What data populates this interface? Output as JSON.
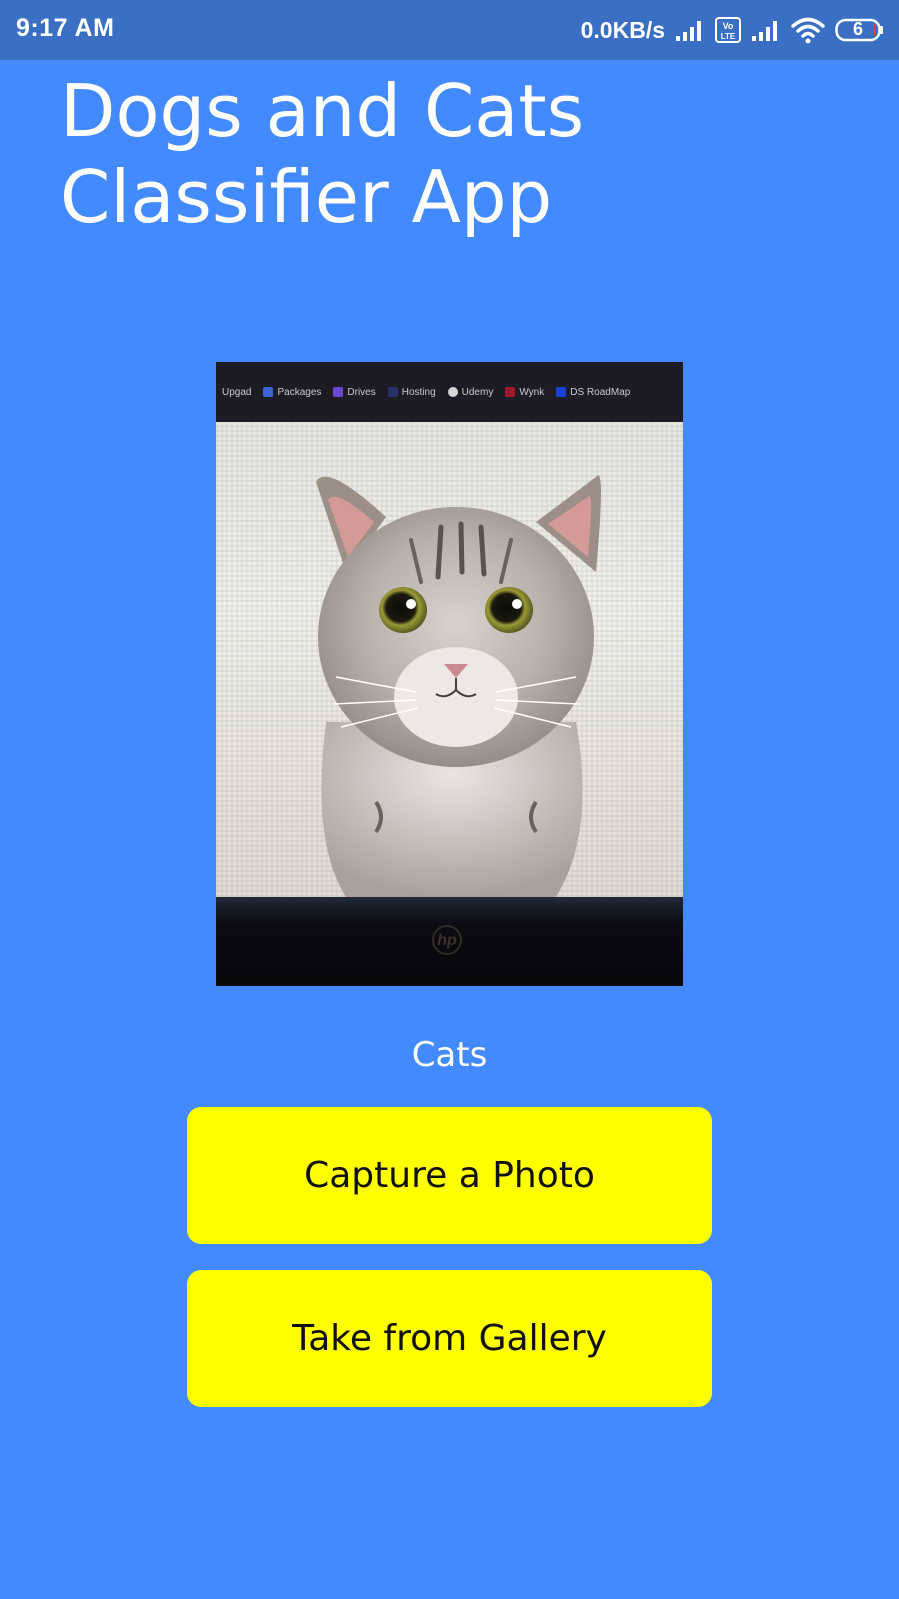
{
  "status_bar": {
    "time": "9:17 AM",
    "net_speed": "0.0KB/s",
    "volte_label": "Vo LTE",
    "battery_level": "6",
    "icons": [
      "signal-icon",
      "volte-icon",
      "signal-icon",
      "wifi-icon",
      "battery-icon"
    ]
  },
  "app": {
    "title": "Dogs and Cats Classifier App",
    "result": "Cats",
    "capture_button_label": "Capture a Photo",
    "gallery_button_label": "Take from Gallery"
  },
  "photo": {
    "description_icon": "cat-photo",
    "bookmarks": [
      "Upgad",
      "Packages",
      "Drives",
      "Hosting",
      "Udemy",
      "Wynk",
      "DS RoadMap"
    ],
    "logo_text": "hp"
  },
  "colors": {
    "background": "#448aff",
    "status_bar": "#3a6fc4",
    "button": "#ffff00"
  }
}
